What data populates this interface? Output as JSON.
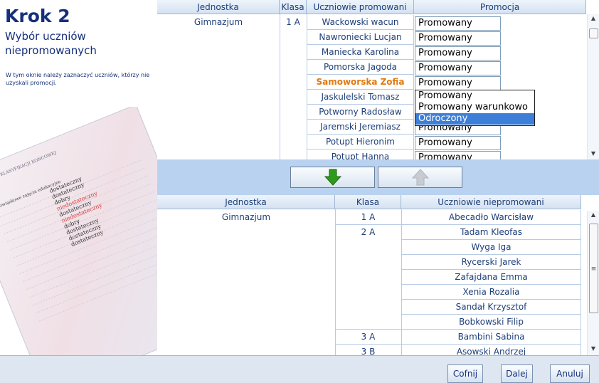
{
  "step": {
    "title": "Krok 2",
    "subtitle": "Wybór uczniów niepromowanych",
    "description": "W tym oknie należy zaznaczyć uczniów, którzy nie uzyskali promocji."
  },
  "top_table": {
    "headers": [
      "Jednostka",
      "Klasa",
      "Uczniowie promowani",
      "Promocja"
    ],
    "unit": "Gimnazjum",
    "class": "1 A",
    "rows": [
      {
        "student": "Wackowski wacun",
        "promotion": "Promowany"
      },
      {
        "student": "Nawroniecki Lucjan",
        "promotion": "Promowany"
      },
      {
        "student": "Maniecka Karolina",
        "promotion": "Promowany"
      },
      {
        "student": "Pomorska Jagoda",
        "promotion": "Promowany"
      },
      {
        "student": "Samoworska Zofia",
        "promotion": "Promowany",
        "selected": true
      },
      {
        "student": "Jaskulelski Tomasz",
        "promotion": "Promowany"
      },
      {
        "student": "Potworny Radosław",
        "promotion": "Promowany"
      },
      {
        "student": "Jaremski Jeremiasz",
        "promotion": "Promowany"
      },
      {
        "student": "Potupt Hieronim",
        "promotion": "Promowany"
      },
      {
        "student": "Potupt Hanna",
        "promotion": "Promowany"
      }
    ]
  },
  "dropdown": {
    "options": [
      "Promowany",
      "Promowany warunkowo",
      "Odroczony"
    ],
    "highlighted": "Odroczony"
  },
  "buttons": {
    "move_down_icon": "arrow-down-green-icon",
    "move_up_icon": "arrow-up-gray-icon",
    "back": "Cofnij",
    "next": "Dalej",
    "cancel": "Anuluj"
  },
  "bottom_table": {
    "headers": [
      "Jednostka",
      "Klasa",
      "Uczniowie niepromowani"
    ],
    "unit": "Gimnazjum",
    "groups": [
      {
        "class": "1 A",
        "students": [
          "Abecadło Warcisław"
        ]
      },
      {
        "class": "2 A",
        "students": [
          "Tadam Kleofas",
          "Wyga Iga",
          "Rycerski Jarek",
          "Zafajdana Emma",
          "Xenia Rozalia",
          "Sandał Krzysztof",
          "Bobkowski Filip"
        ]
      },
      {
        "class": "3 A",
        "students": [
          "Bambini Sabina"
        ]
      },
      {
        "class": "3 B",
        "students": [
          "Asowski Andrzej"
        ]
      }
    ]
  },
  "art": {
    "lines": [
      "dostateczny",
      "dostateczny",
      "dobry",
      "niedostateczny",
      "dostateczny",
      "niedostateczny",
      "dobry",
      "dostateczny",
      "dostateczny",
      "dostateczny"
    ],
    "header_text": "WYNIKI KLASYFIKACJI KOŃCOWEJ",
    "section_text": "Obowiązkowe zajęcia edukacyjne"
  },
  "colors": {
    "selected_student": "#e07a10",
    "header_text": "#15307b",
    "band": "#b9d2ef",
    "highlight": "#3d7fd8"
  }
}
